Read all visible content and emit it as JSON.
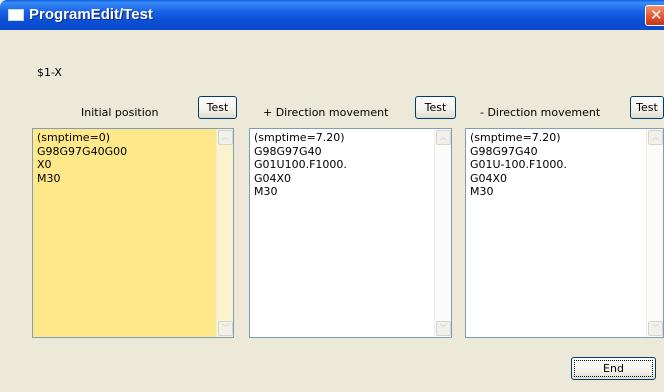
{
  "window": {
    "title": "ProgramEdit/Test"
  },
  "axis": {
    "label": "$1-X"
  },
  "panels": [
    {
      "label": "Initial position",
      "test_label": "Test",
      "content": "(smptime=0)\nG98G97G40G00\nX0\nM30",
      "bg": "#ffe88a"
    },
    {
      "label": "+ Direction movement",
      "test_label": "Test",
      "content": "(smptime=7.20)\nG98G97G40\nG01U100.F1000.\nG04X0\nM30",
      "bg": "#ffffff"
    },
    {
      "label": "- Direction movement",
      "test_label": "Test",
      "content": "(smptime=7.20)\nG98G97G40\nG01U-100.F1000.\nG04X0\nM30",
      "bg": "#ffffff"
    }
  ],
  "footer": {
    "end_label": "End"
  },
  "icons": {
    "close": "close-icon",
    "scroll_up": "chevron-up-icon",
    "scroll_down": "chevron-down-icon"
  }
}
